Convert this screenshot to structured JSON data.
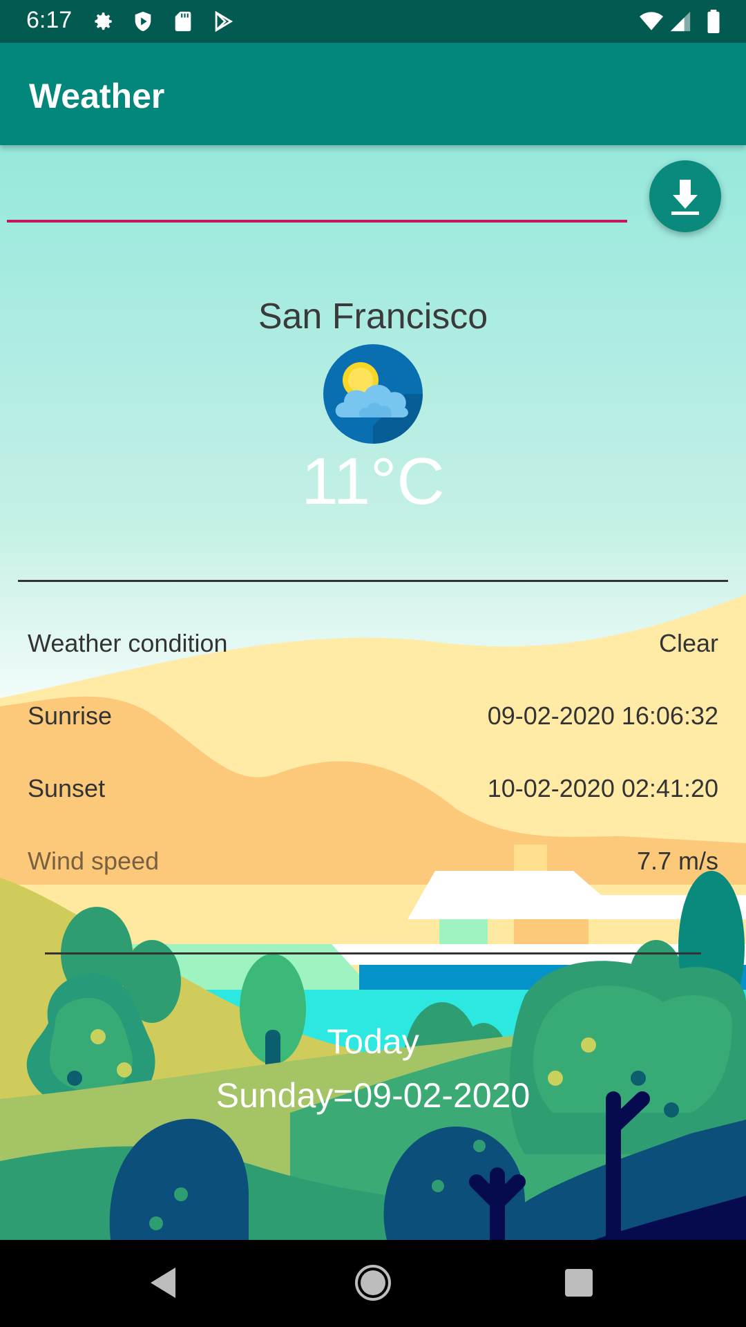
{
  "status_bar": {
    "time": "6:17",
    "icons": [
      "gear-icon",
      "shield-icon",
      "sd-card-icon",
      "play-store-icon",
      "wifi-icon",
      "signal-icon",
      "battery-icon"
    ]
  },
  "app_bar": {
    "title": "Weather"
  },
  "search": {
    "value": "",
    "placeholder": "",
    "underline_color": "#c2185b"
  },
  "fab": {
    "icon": "download-icon",
    "color": "#0a8a7c"
  },
  "weather": {
    "city": "San Francisco",
    "icon": "partly-cloudy-icon",
    "temperature": "11°C"
  },
  "details": [
    {
      "label": "Weather condition",
      "value": "Clear"
    },
    {
      "label": "Sunrise",
      "value": "09-02-2020 16:06:32"
    },
    {
      "label": "Sunset",
      "value": "10-02-2020 02:41:20"
    },
    {
      "label": "Wind speed",
      "value": "7.7 m/s"
    }
  ],
  "forecast": {
    "heading": "Today",
    "date_line": "Sunday=09-02-2020"
  },
  "nav": {
    "buttons": [
      "back-icon",
      "home-icon",
      "recents-icon"
    ]
  },
  "colors": {
    "status_bar": "#035a50",
    "app_bar": "#03877a",
    "accent": "#c2185b"
  }
}
